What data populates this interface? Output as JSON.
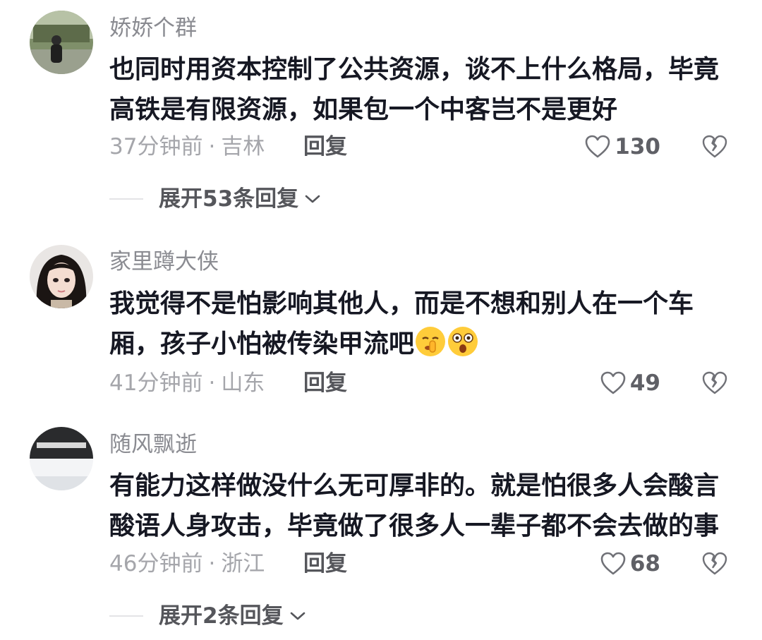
{
  "comments": [
    {
      "username": "娇娇个群",
      "text_lines": [
        "也同时用资本控制了公共资源，谈不上什么格局，毕竟",
        "高铁是有限资源，如果包一个中客岂不是更好"
      ],
      "time": "37分钟前",
      "location": "吉林",
      "reply_label": "回复",
      "likes": "130",
      "expand_label": "展开53条回复"
    },
    {
      "username": "家里蹲大侠",
      "text_lines": [
        "我觉得不是怕影响其他人，而是不想和别人在一个车",
        "厢，孩子小怕被传染甲流吧"
      ],
      "emojis": [
        "shushing-face-icon",
        "shocked-face-icon"
      ],
      "time": "41分钟前",
      "location": "山东",
      "reply_label": "回复",
      "likes": "49"
    },
    {
      "username": "随风飘逝",
      "text_lines": [
        "有能力这样做没什么无可厚非的。就是怕很多人会酸言",
        "酸语人身攻击，毕竟做了很多人一辈子都不会去做的事"
      ],
      "time": "46分钟前",
      "location": "浙江",
      "reply_label": "回复",
      "likes": "68",
      "expand_label": "展开2条回复"
    }
  ],
  "meta_separator": "·",
  "colors": {
    "text": "#161823",
    "muted": "#a5a6ab",
    "username": "#8a8b91"
  }
}
